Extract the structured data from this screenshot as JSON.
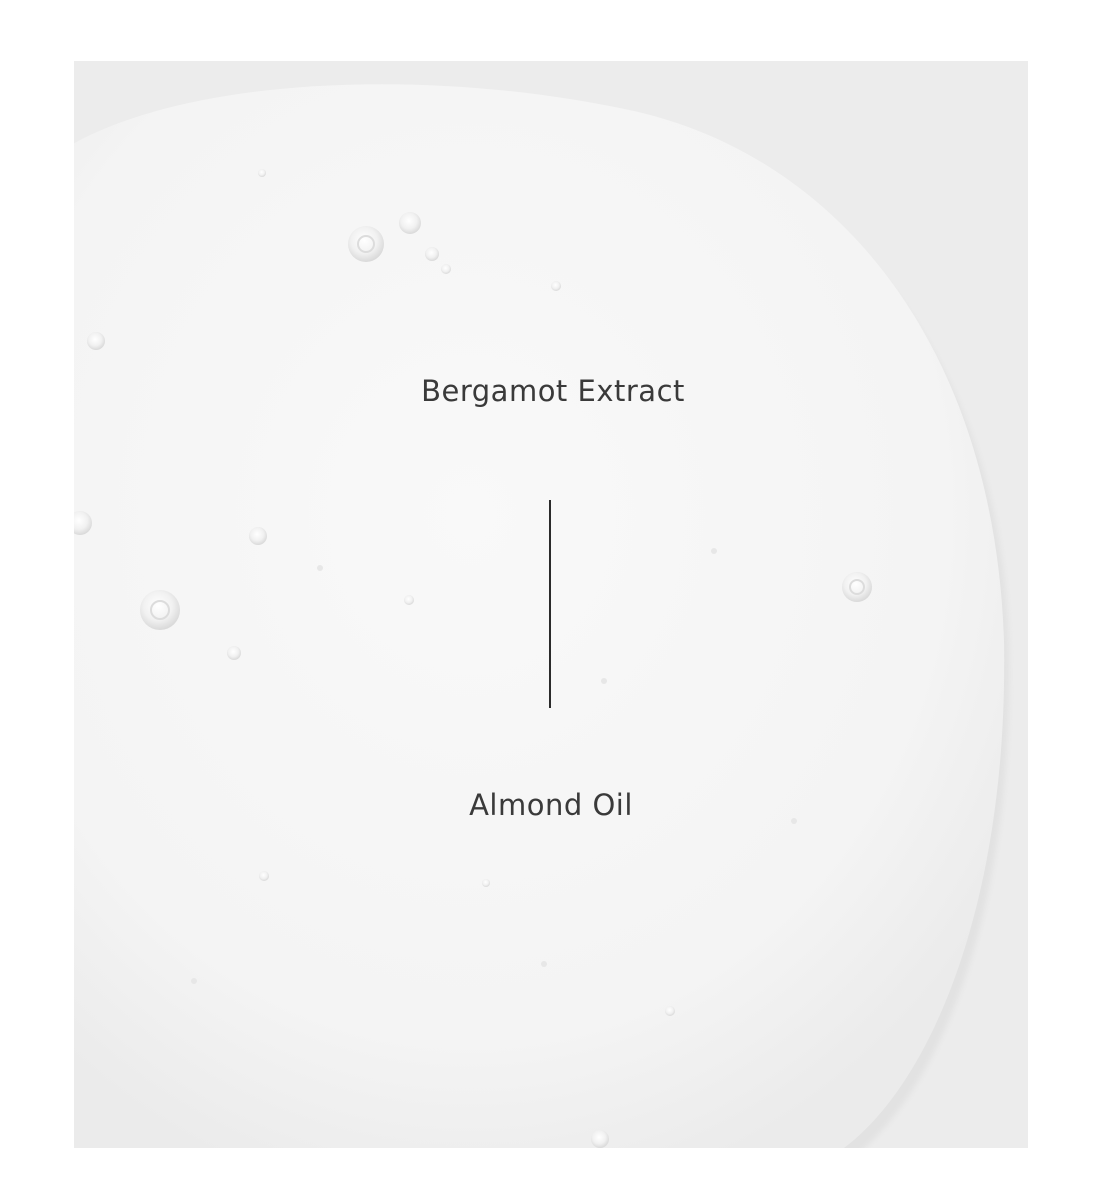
{
  "ingredients": {
    "top": "Bergamot Extract",
    "bottom": "Almond Oil"
  },
  "colors": {
    "background": "#ffffff",
    "surface": "#ececec",
    "swatch": "#f6f6f6",
    "text": "#3a3a3a",
    "divider": "#2b2b2b"
  }
}
